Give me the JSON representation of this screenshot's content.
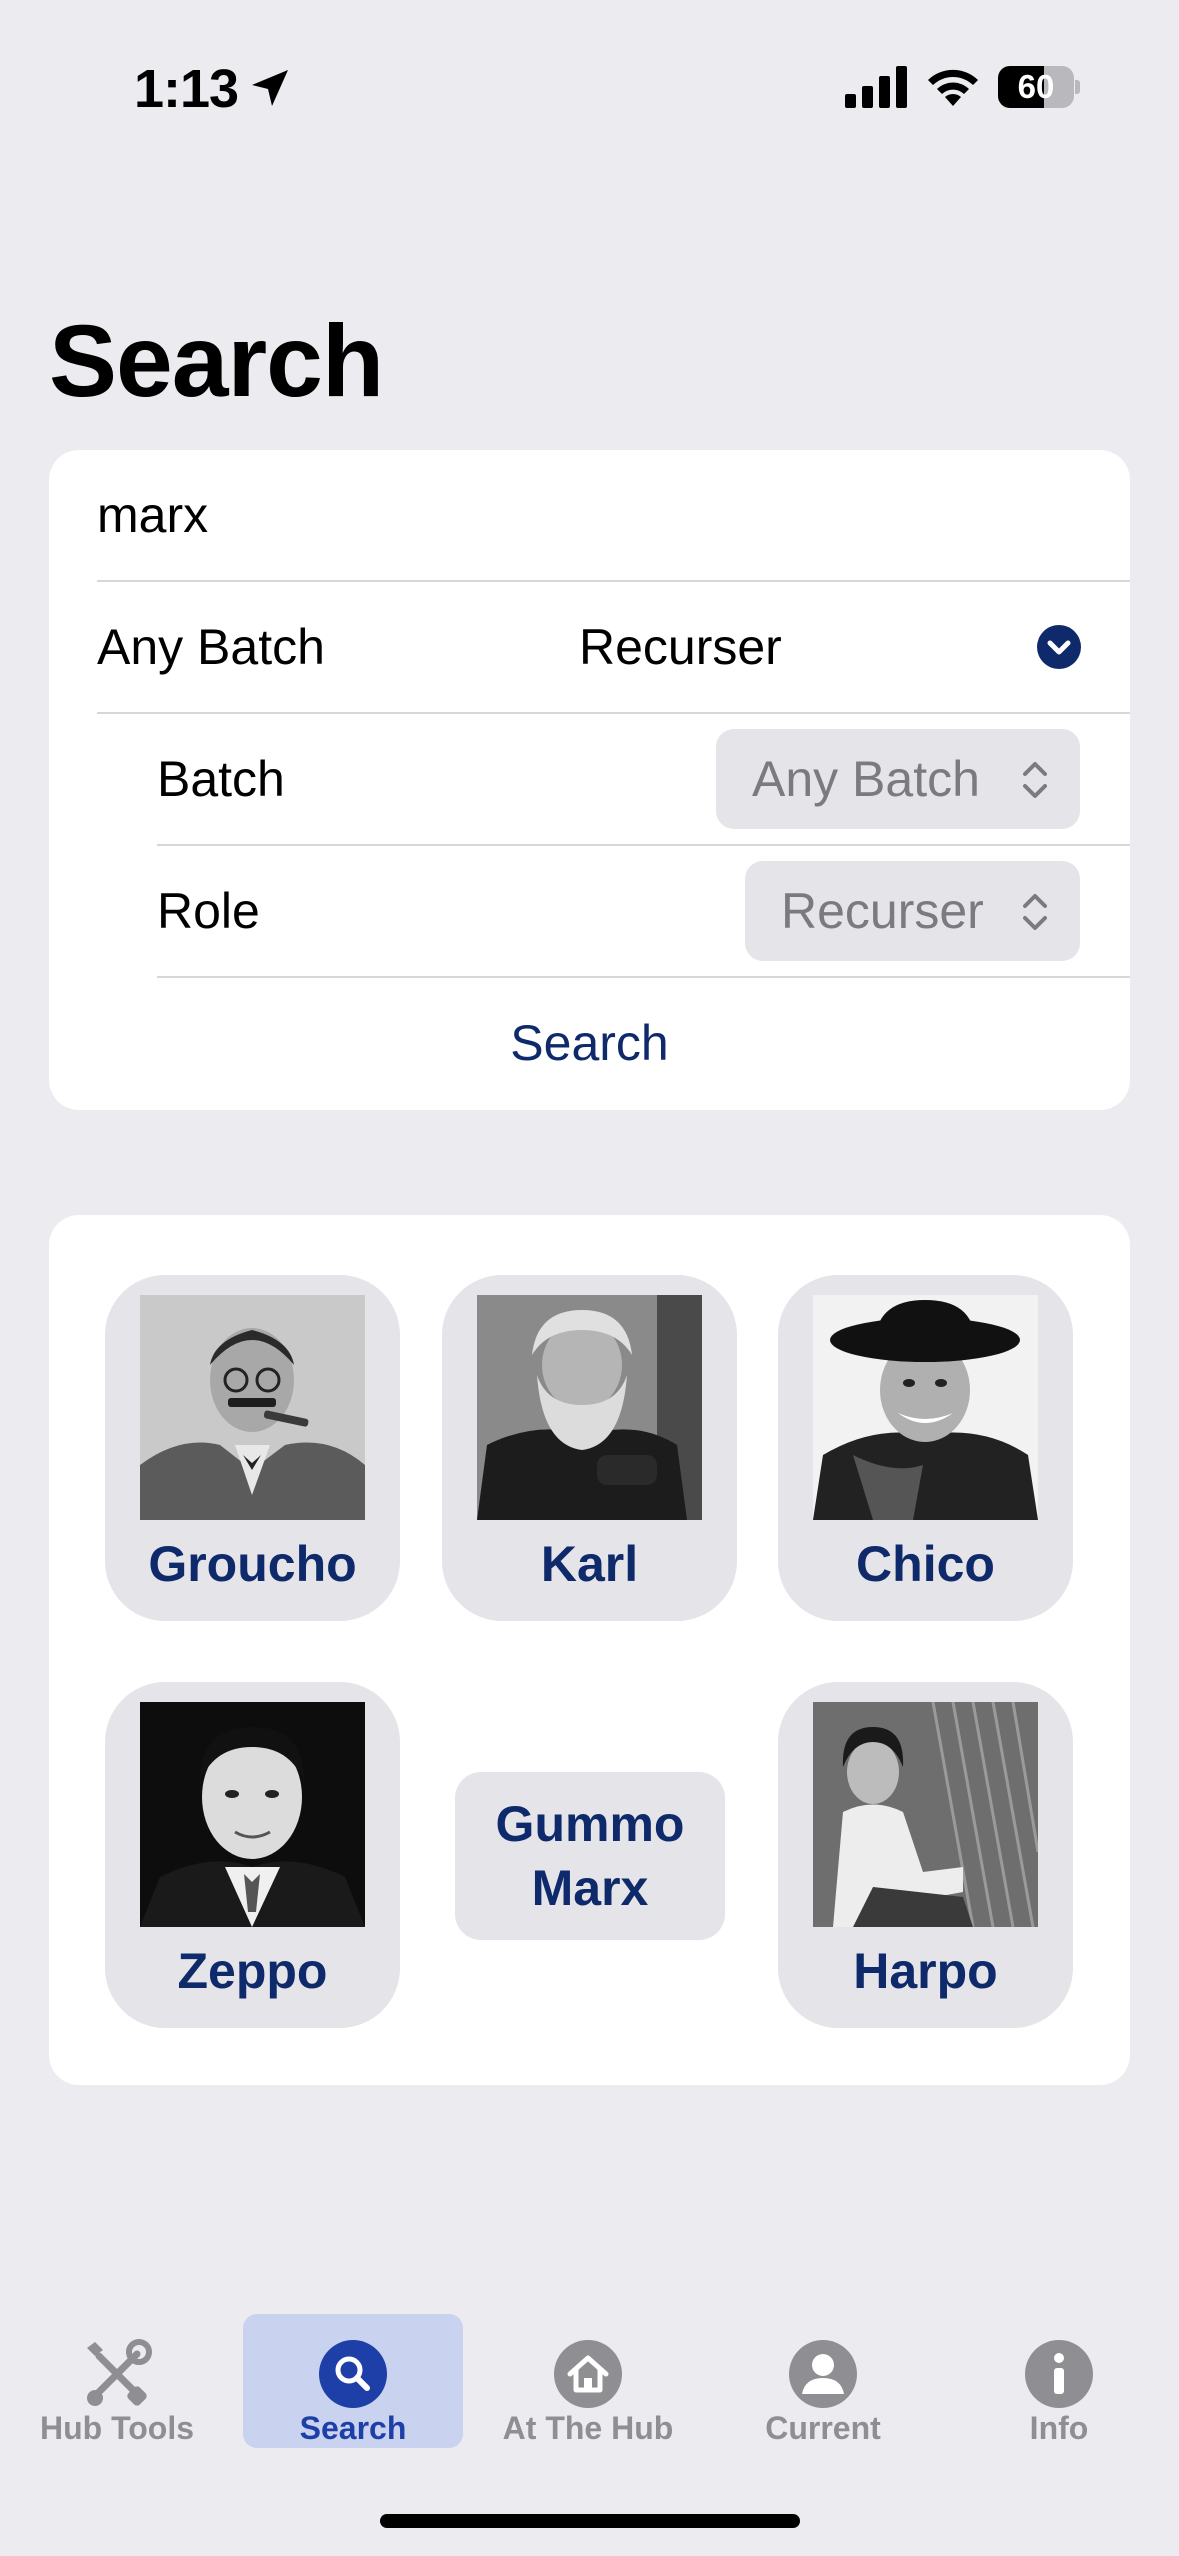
{
  "status_bar": {
    "time": "1:13",
    "battery": "60",
    "battery_level": 0.6
  },
  "page_title": "Search",
  "form": {
    "search_value": "marx",
    "search_placeholder": "",
    "filter_summary_batch": "Any Batch",
    "filter_summary_role": "Recurser",
    "batch_label": "Batch",
    "batch_value": "Any Batch",
    "role_label": "Role",
    "role_value": "Recurser",
    "search_button": "Search"
  },
  "results": [
    {
      "name": "Groucho",
      "photo": "groucho-portrait"
    },
    {
      "name": "Karl",
      "photo": "karl-portrait"
    },
    {
      "name": "Chico",
      "photo": "chico-portrait"
    },
    {
      "name": "Zeppo",
      "photo": "zeppo-portrait"
    },
    {
      "name": "Gummo Marx",
      "line1": "Gummo",
      "line2": "Marx",
      "photo": null
    },
    {
      "name": "Harpo",
      "photo": "harpo-portrait"
    }
  ],
  "tabs": [
    {
      "label": "Hub Tools",
      "icon": "tools-icon",
      "active": false
    },
    {
      "label": "Search",
      "icon": "search-icon",
      "active": true
    },
    {
      "label": "At The Hub",
      "icon": "home-icon",
      "active": false
    },
    {
      "label": "Current",
      "icon": "person-icon",
      "active": false
    },
    {
      "label": "Info",
      "icon": "info-icon",
      "active": false
    }
  ],
  "colors": {
    "accent": "#0F2A6B",
    "active_tab_bg": "#C9D2EE",
    "active_tab_label": "#1E3FA8",
    "background": "#EBEBF0"
  }
}
